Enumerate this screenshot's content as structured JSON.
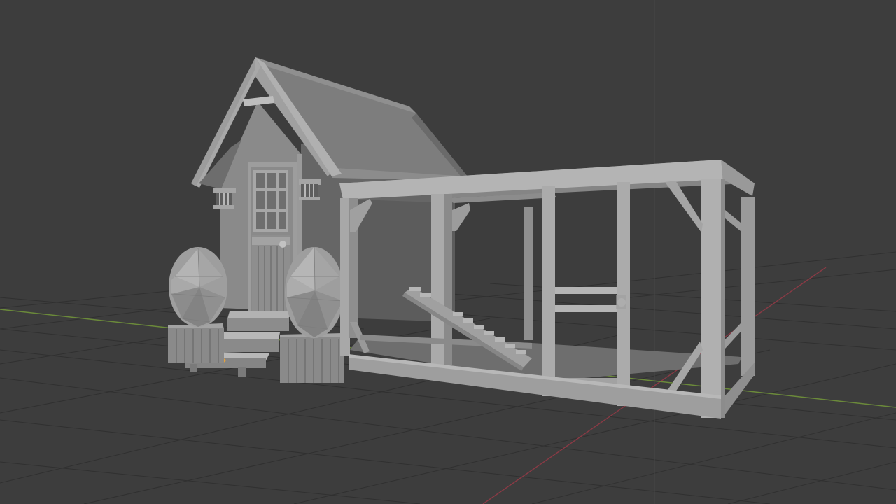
{
  "viewport": {
    "view_type": "3d-viewport",
    "shading_mode": "solid",
    "background_color": "#3d3d3d",
    "grid_color": "#2f2f2f",
    "x_axis_color": "#8a3a45",
    "y_axis_color": "#6b8a3a",
    "z_axis_color": "#4a4a4a",
    "origin_marker_color": "#e0a040"
  },
  "scene": {
    "objects": [
      {
        "name": "cottage",
        "icon": "cube-icon"
      },
      {
        "name": "roof",
        "icon": "cube-icon"
      },
      {
        "name": "front-door",
        "icon": "cube-icon"
      },
      {
        "name": "wall-lantern-left",
        "icon": "cube-icon"
      },
      {
        "name": "wall-lantern-right",
        "icon": "cube-icon"
      },
      {
        "name": "porch-steps",
        "icon": "cube-icon"
      },
      {
        "name": "planter-left",
        "icon": "cube-icon"
      },
      {
        "name": "planter-right",
        "icon": "cube-icon"
      },
      {
        "name": "topiary-left",
        "icon": "icosphere-icon"
      },
      {
        "name": "topiary-right",
        "icon": "icosphere-icon"
      },
      {
        "name": "run-frame",
        "icon": "cube-icon"
      },
      {
        "name": "run-door",
        "icon": "cube-icon"
      },
      {
        "name": "ramp",
        "icon": "cube-icon"
      }
    ]
  }
}
